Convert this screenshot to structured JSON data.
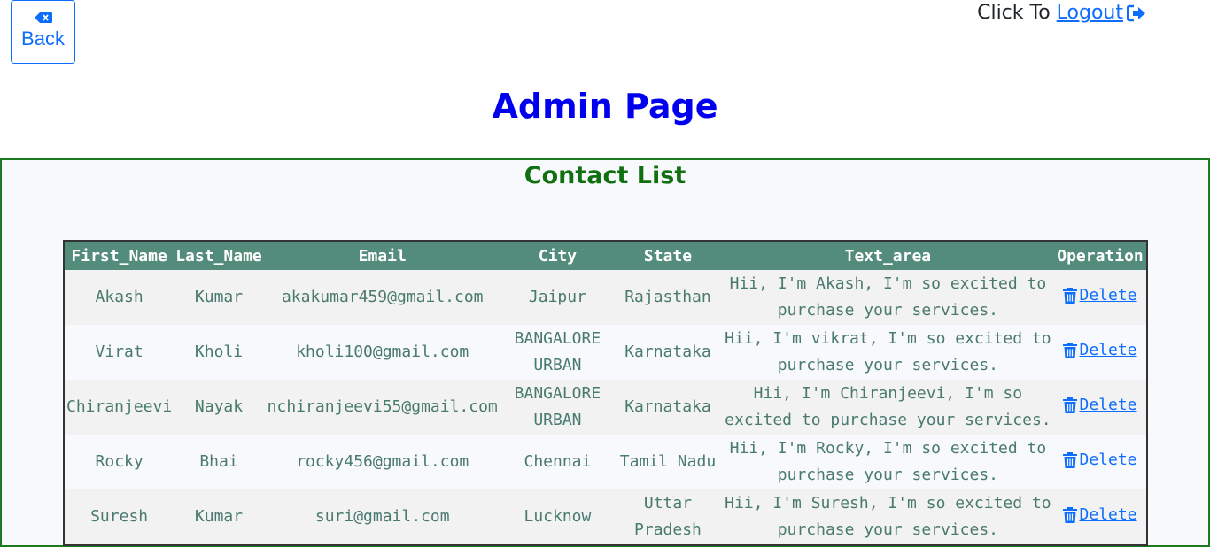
{
  "header": {
    "back_label": "Back",
    "logout_prefix": "Click To",
    "logout_label": "Logout"
  },
  "page_title": "Admin Page",
  "contacts": {
    "title": "Contact List",
    "columns": [
      "First_Name",
      "Last_Name",
      "Email",
      "City",
      "State",
      "Text_area",
      "Operation"
    ],
    "rows": [
      {
        "first": "Akash",
        "last": "Kumar",
        "email": "akakumar459@gmail.com",
        "city": "Jaipur",
        "state": "Rajasthan",
        "text": "Hii, I'm Akash, I'm so excited to purchase your services.",
        "op": "Delete"
      },
      {
        "first": "Virat",
        "last": "Kholi",
        "email": "kholi100@gmail.com",
        "city": "BANGALORE URBAN",
        "state": "Karnataka",
        "text": "Hii, I'm vikrat, I'm so excited to purchase your services.",
        "op": "Delete"
      },
      {
        "first": "Chiranjeevi",
        "last": "Nayak",
        "email": "nchiranjeevi55@gmail.com",
        "city": "BANGALORE URBAN",
        "state": "Karnataka",
        "text": "Hii, I'm Chiranjeevi, I'm so excited to purchase your services.",
        "op": "Delete"
      },
      {
        "first": "Rocky",
        "last": "Bhai",
        "email": "rocky456@gmail.com",
        "city": "Chennai",
        "state": "Tamil Nadu",
        "text": "Hii, I'm Rocky, I'm so excited to purchase your services.",
        "op": "Delete"
      },
      {
        "first": "Suresh",
        "last": "Kumar",
        "email": "suri@gmail.com",
        "city": "Lucknow",
        "state": "Uttar Pradesh",
        "text": "Hii, I'm Suresh, I'm so excited to purchase your services.",
        "op": "Delete"
      }
    ]
  },
  "colors": {
    "primary": "#0d6efd",
    "title": "#0000ee",
    "panel_border": "#1e7a1e",
    "table_header": "#548c7c",
    "cell_text": "#4a7a6e"
  },
  "icons": {
    "back": "backspace-icon",
    "logout": "sign-out-icon",
    "delete": "trash-icon"
  }
}
